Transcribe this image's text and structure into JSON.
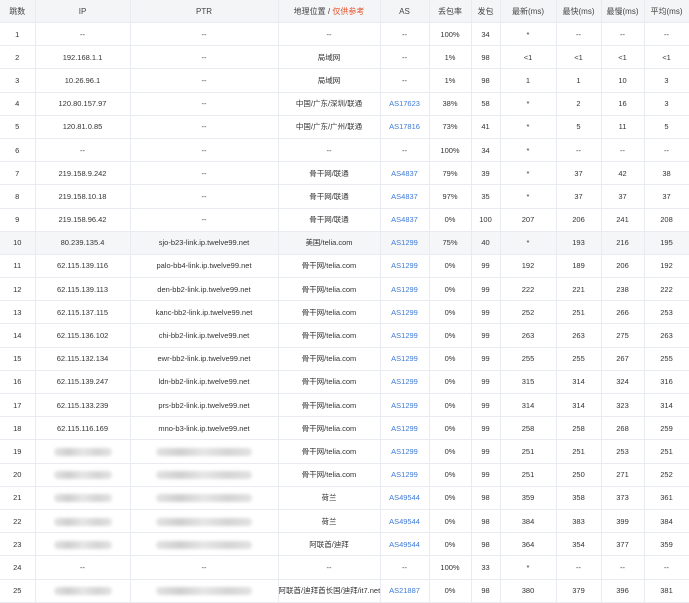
{
  "header": {
    "hop": "跳数",
    "ip": "IP",
    "ptr": "PTR",
    "geo": "地理位置",
    "geo_sep": " / ",
    "geo_note": "仅供参考",
    "as": "AS",
    "loss": "丢包率",
    "sent": "发包",
    "last": "最新(ms)",
    "best": "最快(ms)",
    "worst": "最慢(ms)",
    "avg": "平均(ms)"
  },
  "rows": [
    {
      "hop": "1",
      "ip": "--",
      "ptr": "--",
      "geo": "--",
      "as": "--",
      "loss": "100%",
      "sent": "34",
      "last": "*",
      "best": "--",
      "worst": "--",
      "avg": "--"
    },
    {
      "hop": "2",
      "ip": "192.168.1.1",
      "ptr": "--",
      "geo": "局域网",
      "as": "--",
      "loss": "1%",
      "sent": "98",
      "last": "<1",
      "best": "<1",
      "worst": "<1",
      "avg": "<1"
    },
    {
      "hop": "3",
      "ip": "10.26.96.1",
      "ptr": "--",
      "geo": "局域网",
      "as": "--",
      "loss": "1%",
      "sent": "98",
      "last": "1",
      "best": "1",
      "worst": "10",
      "avg": "3"
    },
    {
      "hop": "4",
      "ip": "120.80.157.97",
      "ptr": "--",
      "geo": "中国/广东/深圳/联通",
      "as": "AS17623",
      "loss": "38%",
      "sent": "58",
      "last": "*",
      "best": "2",
      "worst": "16",
      "avg": "3"
    },
    {
      "hop": "5",
      "ip": "120.81.0.85",
      "ptr": "--",
      "geo": "中国/广东/广州/联通",
      "as": "AS17816",
      "loss": "73%",
      "sent": "41",
      "last": "*",
      "best": "5",
      "worst": "11",
      "avg": "5"
    },
    {
      "hop": "6",
      "ip": "--",
      "ptr": "--",
      "geo": "--",
      "as": "--",
      "loss": "100%",
      "sent": "34",
      "last": "*",
      "best": "--",
      "worst": "--",
      "avg": "--"
    },
    {
      "hop": "7",
      "ip": "219.158.9.242",
      "ptr": "--",
      "geo": "骨干网/联通",
      "as": "AS4837",
      "loss": "79%",
      "sent": "39",
      "last": "*",
      "best": "37",
      "worst": "42",
      "avg": "38"
    },
    {
      "hop": "8",
      "ip": "219.158.10.18",
      "ptr": "--",
      "geo": "骨干网/联通",
      "as": "AS4837",
      "loss": "97%",
      "sent": "35",
      "last": "*",
      "best": "37",
      "worst": "37",
      "avg": "37"
    },
    {
      "hop": "9",
      "ip": "219.158.96.42",
      "ptr": "--",
      "geo": "骨干网/联通",
      "as": "AS4837",
      "loss": "0%",
      "sent": "100",
      "last": "207",
      "best": "206",
      "worst": "241",
      "avg": "208"
    },
    {
      "hop": "10",
      "ip": "80.239.135.4",
      "ptr": "sjo-b23-link.ip.twelve99.net",
      "geo": "美国/telia.com",
      "as": "AS1299",
      "loss": "75%",
      "sent": "40",
      "last": "*",
      "best": "193",
      "worst": "216",
      "avg": "195",
      "hl": true
    },
    {
      "hop": "11",
      "ip": "62.115.139.116",
      "ptr": "palo-bb4-link.ip.twelve99.net",
      "geo": "骨干网/telia.com",
      "as": "AS1299",
      "loss": "0%",
      "sent": "99",
      "last": "192",
      "best": "189",
      "worst": "206",
      "avg": "192"
    },
    {
      "hop": "12",
      "ip": "62.115.139.113",
      "ptr": "den-bb2-link.ip.twelve99.net",
      "geo": "骨干网/telia.com",
      "as": "AS1299",
      "loss": "0%",
      "sent": "99",
      "last": "222",
      "best": "221",
      "worst": "238",
      "avg": "222"
    },
    {
      "hop": "13",
      "ip": "62.115.137.115",
      "ptr": "kanc-bb2-link.ip.twelve99.net",
      "geo": "骨干网/telia.com",
      "as": "AS1299",
      "loss": "0%",
      "sent": "99",
      "last": "252",
      "best": "251",
      "worst": "266",
      "avg": "253"
    },
    {
      "hop": "14",
      "ip": "62.115.136.102",
      "ptr": "chi-bb2-link.ip.twelve99.net",
      "geo": "骨干网/telia.com",
      "as": "AS1299",
      "loss": "0%",
      "sent": "99",
      "last": "263",
      "best": "263",
      "worst": "275",
      "avg": "263"
    },
    {
      "hop": "15",
      "ip": "62.115.132.134",
      "ptr": "ewr-bb2-link.ip.twelve99.net",
      "geo": "骨干网/telia.com",
      "as": "AS1299",
      "loss": "0%",
      "sent": "99",
      "last": "255",
      "best": "255",
      "worst": "267",
      "avg": "255"
    },
    {
      "hop": "16",
      "ip": "62.115.139.247",
      "ptr": "ldn-bb2-link.ip.twelve99.net",
      "geo": "骨干网/telia.com",
      "as": "AS1299",
      "loss": "0%",
      "sent": "99",
      "last": "315",
      "best": "314",
      "worst": "324",
      "avg": "316"
    },
    {
      "hop": "17",
      "ip": "62.115.133.239",
      "ptr": "prs-bb2-link.ip.twelve99.net",
      "geo": "骨干网/telia.com",
      "as": "AS1299",
      "loss": "0%",
      "sent": "99",
      "last": "314",
      "best": "314",
      "worst": "323",
      "avg": "314"
    },
    {
      "hop": "18",
      "ip": "62.115.116.169",
      "ptr": "mno-b3-link.ip.twelve99.net",
      "geo": "骨干网/telia.com",
      "as": "AS1299",
      "loss": "0%",
      "sent": "99",
      "last": "258",
      "best": "258",
      "worst": "268",
      "avg": "259"
    },
    {
      "hop": "19",
      "ip": "",
      "ptr": "",
      "geo": "骨干网/telia.com",
      "as": "AS1299",
      "loss": "0%",
      "sent": "99",
      "last": "251",
      "best": "251",
      "worst": "253",
      "avg": "251",
      "blur": true
    },
    {
      "hop": "20",
      "ip": "",
      "ptr": "",
      "geo": "骨干网/telia.com",
      "as": "AS1299",
      "loss": "0%",
      "sent": "99",
      "last": "251",
      "best": "250",
      "worst": "271",
      "avg": "252",
      "blur": true
    },
    {
      "hop": "21",
      "ip": "",
      "ptr": "",
      "geo": "荷兰",
      "as": "AS49544",
      "loss": "0%",
      "sent": "98",
      "last": "359",
      "best": "358",
      "worst": "373",
      "avg": "361",
      "blur": true
    },
    {
      "hop": "22",
      "ip": "",
      "ptr": "",
      "geo": "荷兰",
      "as": "AS49544",
      "loss": "0%",
      "sent": "98",
      "last": "384",
      "best": "383",
      "worst": "399",
      "avg": "384",
      "blur": true
    },
    {
      "hop": "23",
      "ip": "",
      "ptr": "",
      "geo": "阿联酋/迪拜",
      "as": "AS49544",
      "loss": "0%",
      "sent": "98",
      "last": "364",
      "best": "354",
      "worst": "377",
      "avg": "359",
      "blur": true
    },
    {
      "hop": "24",
      "ip": "--",
      "ptr": "--",
      "geo": "--",
      "as": "--",
      "loss": "100%",
      "sent": "33",
      "last": "*",
      "best": "--",
      "worst": "--",
      "avg": "--"
    },
    {
      "hop": "25",
      "ip": "",
      "ptr": "",
      "geo": "阿联酋/迪拜酋长国/迪拜/it7.net",
      "as": "AS21887",
      "loss": "0%",
      "sent": "98",
      "last": "380",
      "best": "379",
      "worst": "396",
      "avg": "381",
      "blur": true
    }
  ],
  "colors": {
    "as_link": "#3f7bd6",
    "geo_note": "#e6502a",
    "header_bg": "#f4f5f7",
    "highlight_row": "#f5f6f8"
  }
}
